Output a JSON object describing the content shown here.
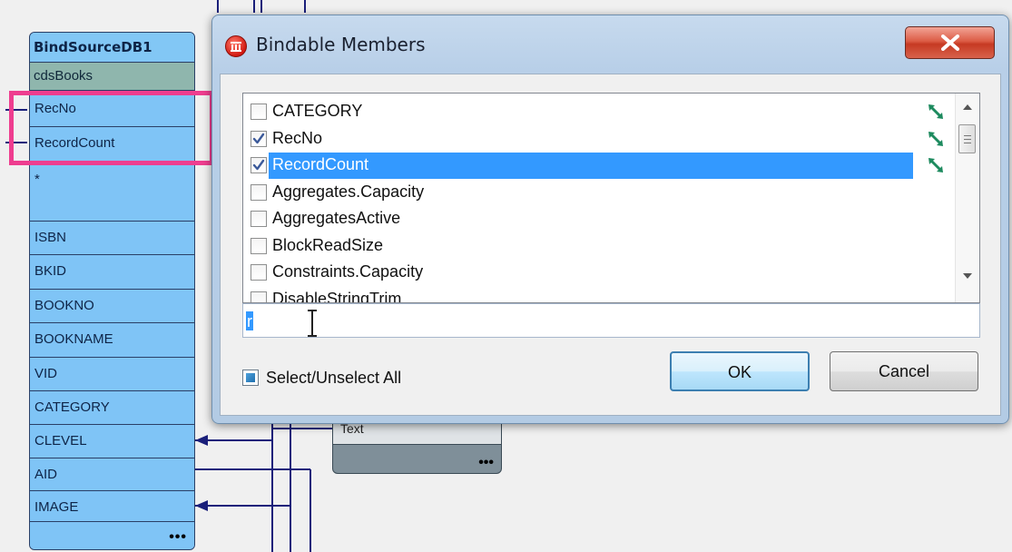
{
  "designer": {
    "node_title": "BindSourceDB1",
    "node_subtitle": "cdsBooks",
    "fields": [
      "RecNo",
      "RecordCount",
      "*",
      "ISBN",
      "BKID",
      "BOOKNO",
      "BOOKNAME",
      "VID",
      "CATEGORY",
      "CLEVEL",
      "AID",
      "IMAGE"
    ],
    "more_label": "•••",
    "text_node_label": "Text",
    "text_node_more": "•••",
    "highlight_color": "#ee3d8f"
  },
  "dialog": {
    "title": "Bindable Members",
    "icon": "app-red-icon",
    "close_icon": "close-icon",
    "members": [
      {
        "label": "CATEGORY",
        "checked": false,
        "linked": true,
        "selected": false
      },
      {
        "label": "RecNo",
        "checked": true,
        "linked": true,
        "selected": false
      },
      {
        "label": "RecordCount",
        "checked": true,
        "linked": true,
        "selected": true
      },
      {
        "label": "Aggregates.Capacity",
        "checked": false,
        "linked": false,
        "selected": false
      },
      {
        "label": "AggregatesActive",
        "checked": false,
        "linked": false,
        "selected": false
      },
      {
        "label": "BlockReadSize",
        "checked": false,
        "linked": false,
        "selected": false
      },
      {
        "label": "Constraints.Capacity",
        "checked": false,
        "linked": false,
        "selected": false
      },
      {
        "label": "DisableStringTrim",
        "checked": false,
        "linked": false,
        "selected": false
      }
    ],
    "filter_value": "r",
    "select_all_label": "Select/Unselect All",
    "ok_label": "OK",
    "cancel_label": "Cancel",
    "selection_color": "#3399ff",
    "link_icon_color": "#1d8a5e"
  }
}
